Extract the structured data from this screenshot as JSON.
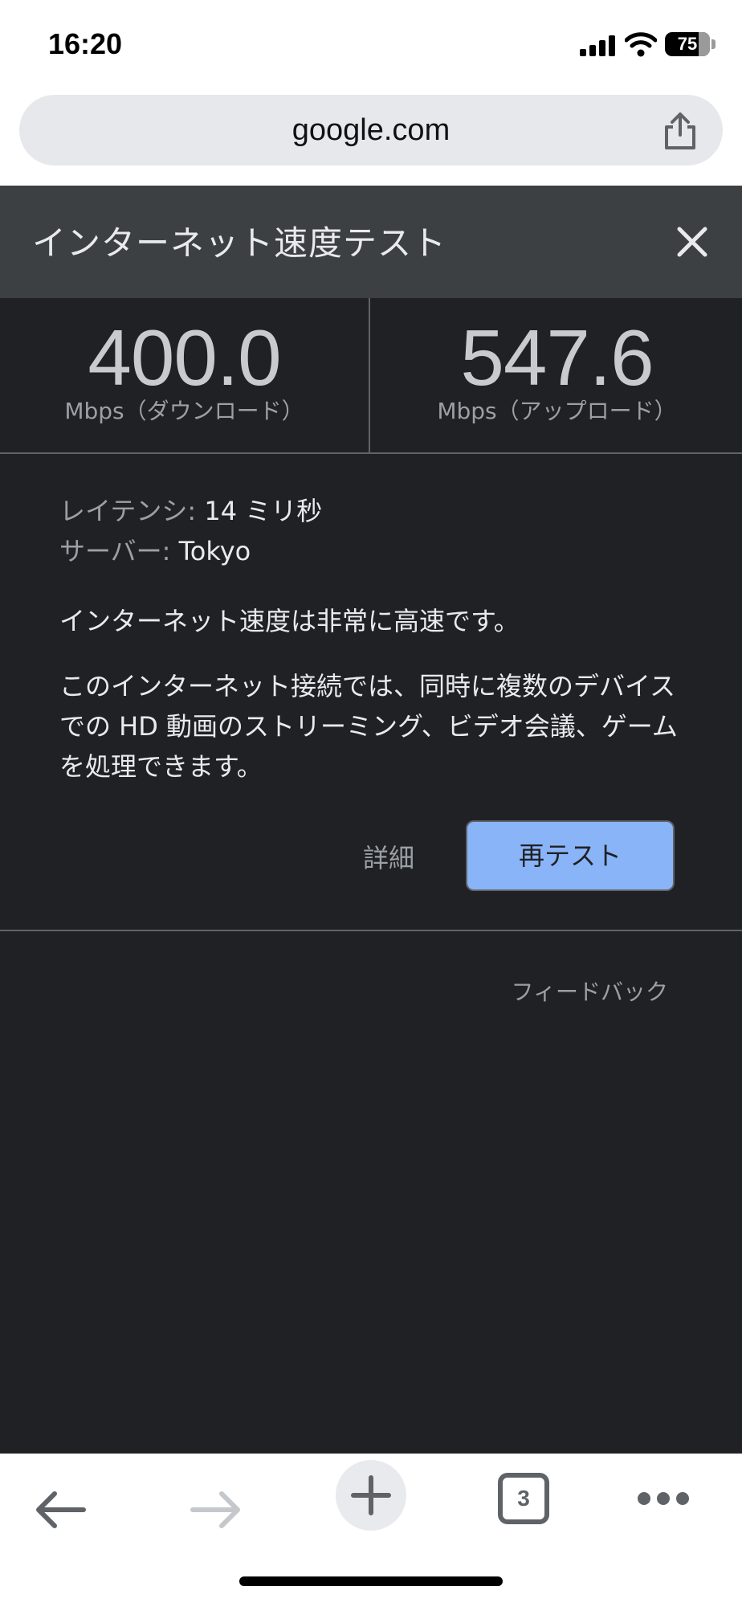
{
  "status_bar": {
    "time": "16:20",
    "battery": "75",
    "battery_level": 0.75
  },
  "browser": {
    "url": "google.com"
  },
  "speed_test": {
    "title": "インターネット速度テスト",
    "download": {
      "value": "400.0",
      "unit": "Mbps（ダウンロード）"
    },
    "upload": {
      "value": "547.6",
      "unit": "Mbps（アップロード）"
    },
    "latency": {
      "label": "レイテンシ:",
      "value": "14 ミリ秒"
    },
    "server": {
      "label": "サーバー:",
      "value": "Tokyo"
    },
    "summary": "インターネット速度は非常に高速です。",
    "description": "このインターネット接続では、同時に複数のデバイスでの HD 動画のストリーミング、ビデオ会議、ゲームを処理できます。",
    "details_label": "詳細",
    "retest_label": "再テスト",
    "feedback_label": "フィードバック"
  },
  "toolbar": {
    "tab_count": "3"
  },
  "colors": {
    "card_background": "#202124",
    "header_background": "#3c4043",
    "accent": "#8ab4f8",
    "text_primary": "#e8eaed",
    "text_secondary": "#9aa0a6"
  },
  "icons": [
    "signal-icon",
    "wifi-icon",
    "battery-icon",
    "share-icon",
    "close-icon",
    "back-arrow-icon",
    "forward-arrow-icon",
    "plus-icon",
    "more-icon"
  ]
}
